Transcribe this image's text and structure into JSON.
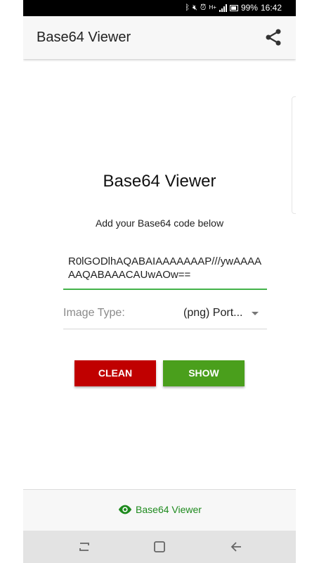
{
  "status_bar": {
    "battery": "99%",
    "time": "16:42"
  },
  "app_bar": {
    "title": "Base64 Viewer",
    "share_icon": "share-icon"
  },
  "content": {
    "title": "Base64 Viewer",
    "subtitle": "Add your Base64 code below",
    "base64_value": "R0lGODlhAQABAIAAAAAAAP///ywAAAAAAQABAAACAUwAOw==",
    "image_type_label": "Image Type:",
    "image_type_value": "(png) Port...",
    "buttons": {
      "clean": "CLEAN",
      "show": "SHOW"
    }
  },
  "bottom_tab": {
    "label": "Base64 Viewer",
    "icon": "eye-icon"
  },
  "colors": {
    "accent_green": "#42b24a",
    "clean_red": "#c00000",
    "show_green": "#4a9f1c",
    "tab_green": "#1e8a1e"
  }
}
